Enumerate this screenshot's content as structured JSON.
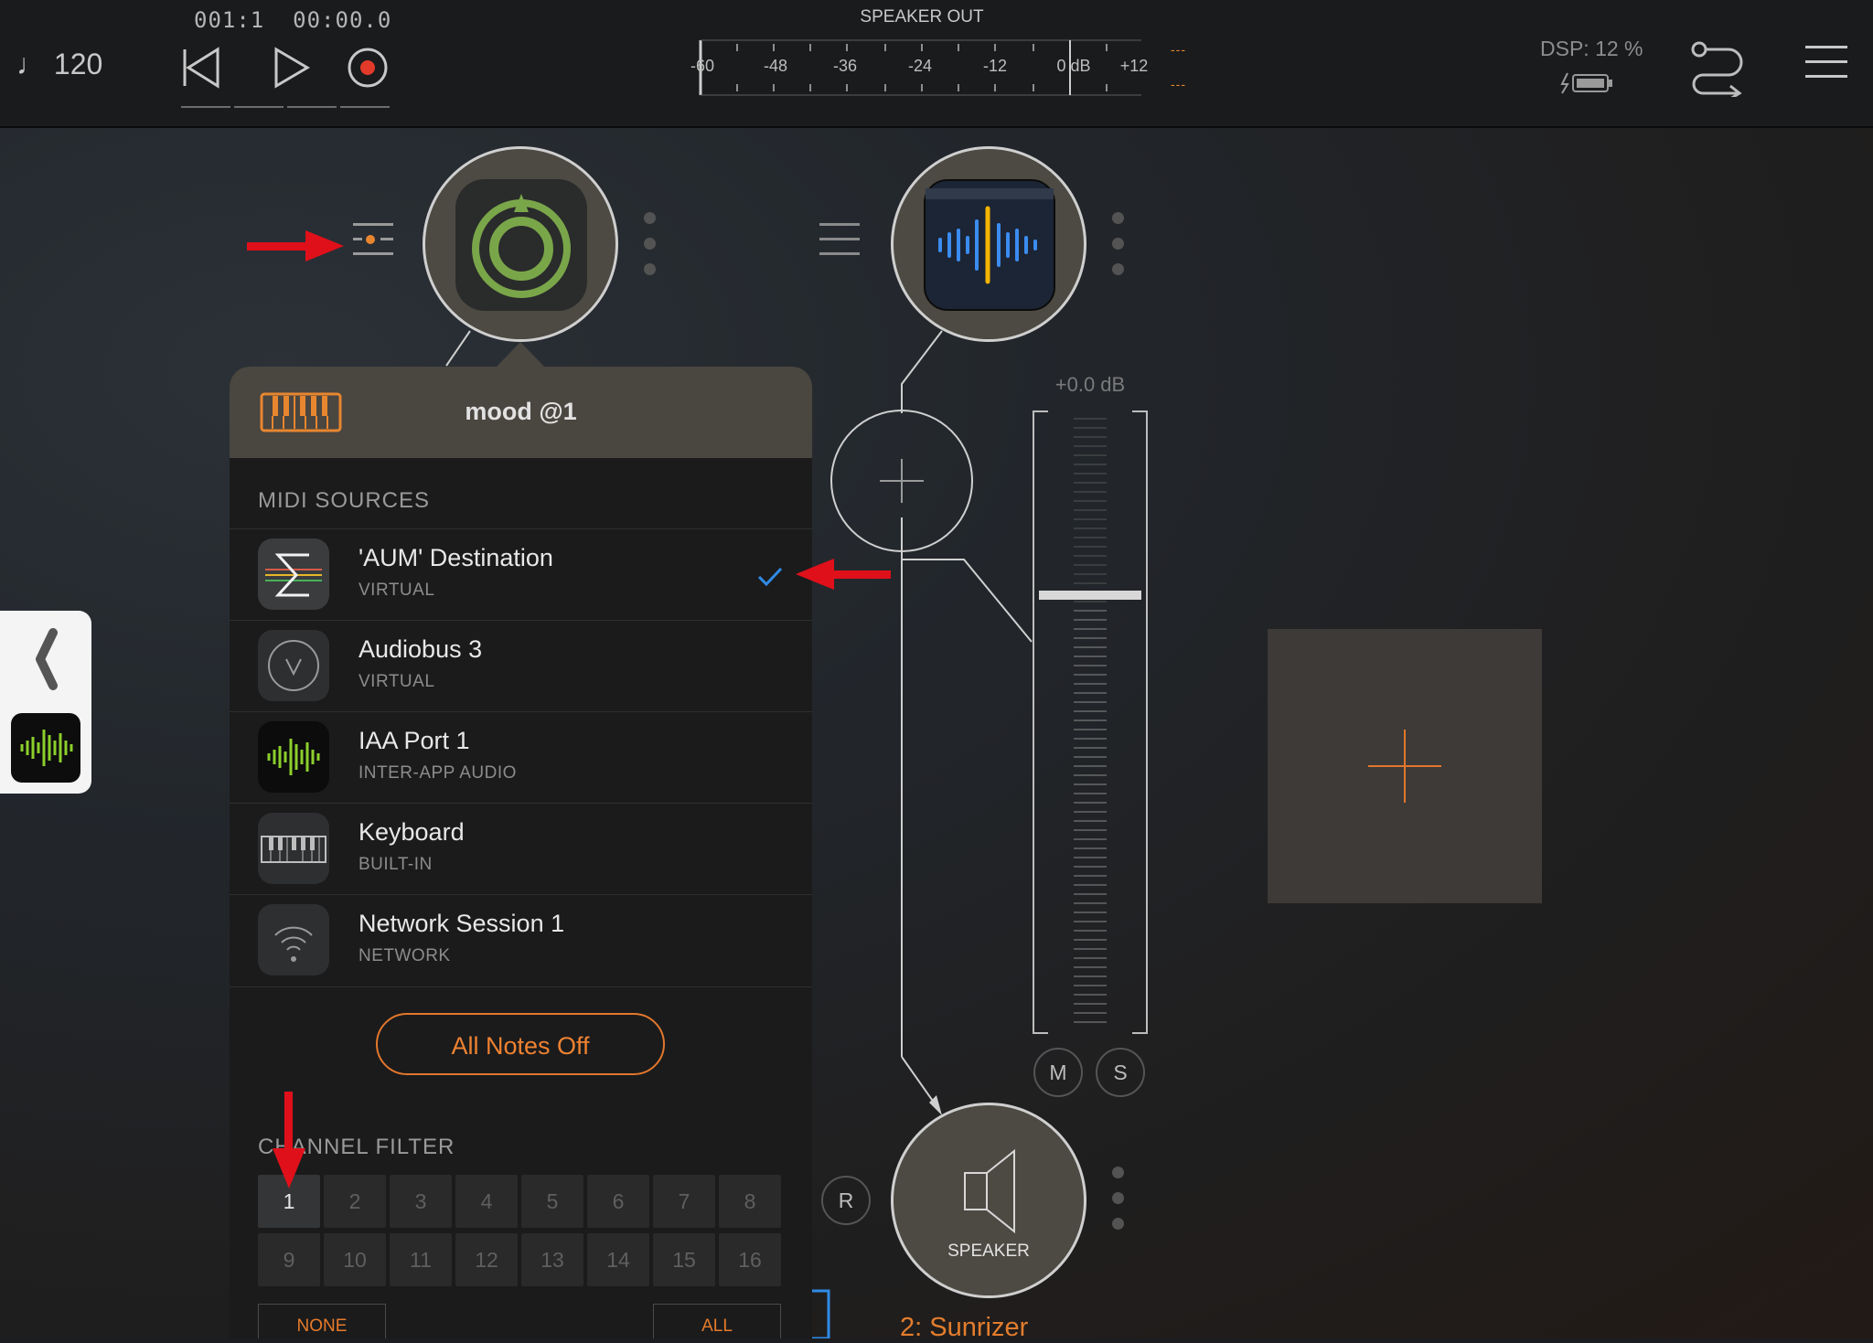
{
  "transport": {
    "tempo": "♩ 120",
    "position": "001:1  00:00.0"
  },
  "meter": {
    "title": "SPEAKER OUT",
    "scale": [
      "-60",
      "-48",
      "-36",
      "-24",
      "-12",
      "0 dB",
      "+12"
    ],
    "peak_left": "---",
    "peak_right": "---"
  },
  "status": {
    "dsp": "DSP: 12 %"
  },
  "popover": {
    "title": "mood @1",
    "midi_sources_header": "MIDI SOURCES",
    "sources": [
      {
        "name": "'AUM' Destination",
        "type": "VIRTUAL",
        "icon": "sigma-icon",
        "checked": true
      },
      {
        "name": "Audiobus 3",
        "type": "VIRTUAL",
        "icon": "audiobus-icon",
        "checked": false
      },
      {
        "name": "IAA Port 1",
        "type": "INTER-APP AUDIO",
        "icon": "waveform-icon",
        "checked": false
      },
      {
        "name": "Keyboard",
        "type": "BUILT-IN",
        "icon": "keyboard-icon",
        "checked": false
      },
      {
        "name": "Network Session 1",
        "type": "NETWORK",
        "icon": "wifi-icon",
        "checked": false
      }
    ],
    "all_notes_off": "All Notes Off",
    "channel_filter_header": "CHANNEL FILTER",
    "channels": [
      "1",
      "2",
      "3",
      "4",
      "5",
      "6",
      "7",
      "8",
      "9",
      "10",
      "11",
      "12",
      "13",
      "14",
      "15",
      "16"
    ],
    "selected_channel": "1",
    "none_label": "NONE",
    "all_label": "ALL"
  },
  "fader": {
    "gain": "+0.0 dB",
    "mute": "M",
    "solo": "S",
    "level": 0.7
  },
  "output": {
    "record": "R",
    "speaker_label": "SPEAKER",
    "channel_name": "2: Sunrizer"
  },
  "colors": {
    "accent": "#ee8231",
    "check": "#2f8be6",
    "annotation_arrow": "#e0101a"
  }
}
